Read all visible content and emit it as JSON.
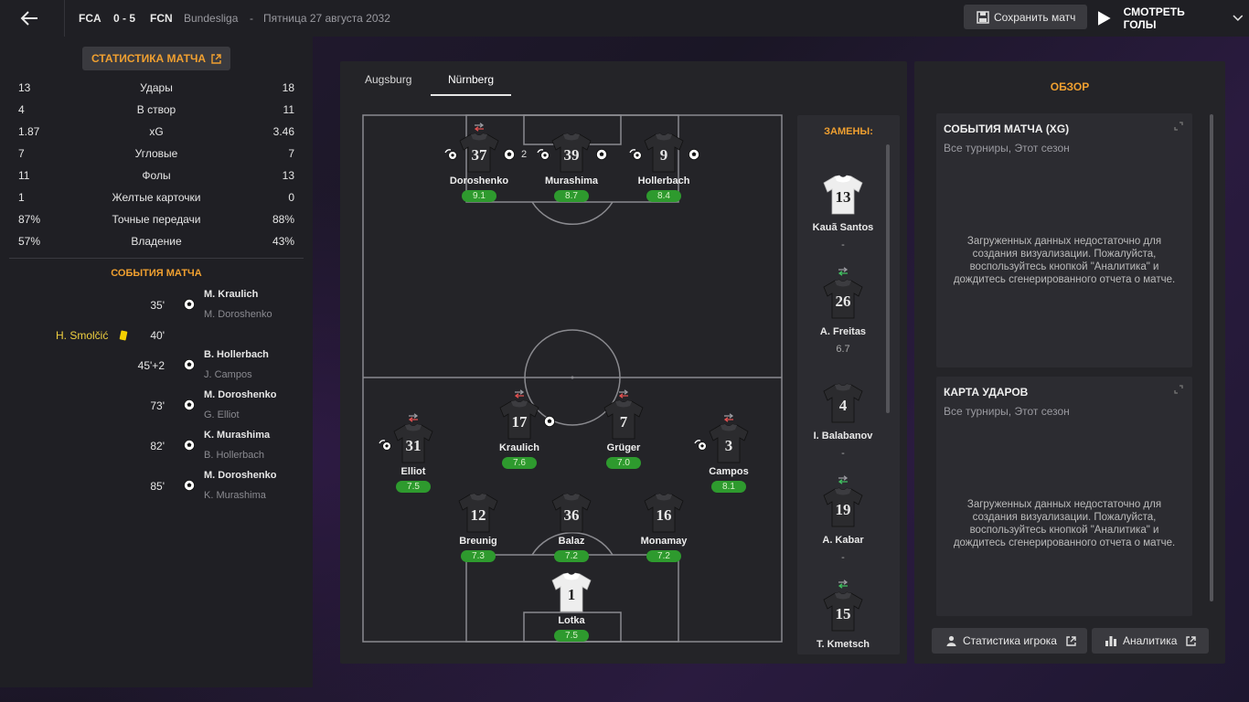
{
  "header": {
    "home_abbr": "FCA",
    "score": "0 - 5",
    "away_abbr": "FCN",
    "competition": "Bundesliga",
    "sep": "-",
    "date": "Пятница 27 августа 2032",
    "save_label": "Сохранить матч",
    "watch_label": "СМОТРЕТЬ ГОЛЫ"
  },
  "left": {
    "stats_button": "СТАТИСТИКА МАТЧА",
    "stats": [
      {
        "home": "13",
        "label": "Удары",
        "away": "18"
      },
      {
        "home": "4",
        "label": "В створ",
        "away": "11"
      },
      {
        "home": "1.87",
        "label": "xG",
        "away": "3.46"
      },
      {
        "home": "7",
        "label": "Угловые",
        "away": "7"
      },
      {
        "home": "11",
        "label": "Фолы",
        "away": "13"
      },
      {
        "home": "1",
        "label": "Желтые карточки",
        "away": "0"
      },
      {
        "home": "87%",
        "label": "Точные передачи",
        "away": "88%"
      },
      {
        "home": "57%",
        "label": "Владение",
        "away": "43%"
      }
    ],
    "events_title": "СОБЫТИЯ МАТЧА",
    "events": [
      {
        "minute": "35'",
        "type": "goal",
        "player": "M. Kraulich",
        "assist": "M. Doroshenko"
      },
      {
        "minute": "40'",
        "type": "yellow",
        "home_player": "H. Smolčić"
      },
      {
        "minute": "45'+2",
        "type": "goal",
        "player": "B. Hollerbach",
        "assist": "J. Campos"
      },
      {
        "minute": "73'",
        "type": "goal",
        "player": "M. Doroshenko",
        "assist": "G. Elliot"
      },
      {
        "minute": "82'",
        "type": "goal",
        "player": "K. Murashima",
        "assist": "B. Hollerbach"
      },
      {
        "minute": "85'",
        "type": "goal",
        "player": "M. Doroshenko",
        "assist": "K. Murashima"
      }
    ]
  },
  "middle": {
    "tabs": [
      "Augsburg",
      "Nürnberg"
    ],
    "active_tab": "Nürnberg",
    "players": [
      {
        "num": "37",
        "name": "Doroshenko",
        "rating": "9.1",
        "kit": "dark",
        "sub_off": true,
        "assist": true,
        "goals": "2"
      },
      {
        "num": "39",
        "name": "Murashima",
        "rating": "8.7",
        "kit": "dark",
        "assist": true,
        "goals": "1"
      },
      {
        "num": "9",
        "name": "Hollerbach",
        "rating": "8.4",
        "kit": "dark",
        "assist": true,
        "goals": "1"
      },
      {
        "num": "31",
        "name": "Elliot",
        "rating": "7.5",
        "kit": "dark",
        "sub_off": true,
        "assist": true
      },
      {
        "num": "17",
        "name": "Kraulich",
        "rating": "7.6",
        "kit": "dark",
        "sub_off": true,
        "goals": "1"
      },
      {
        "num": "7",
        "name": "Grüger",
        "rating": "7.0",
        "kit": "dark",
        "sub_off": true
      },
      {
        "num": "3",
        "name": "Campos",
        "rating": "8.1",
        "kit": "dark",
        "sub_off": true,
        "assist": true
      },
      {
        "num": "12",
        "name": "Breunig",
        "rating": "7.3",
        "kit": "dark"
      },
      {
        "num": "36",
        "name": "Balaz",
        "rating": "7.2",
        "kit": "dark"
      },
      {
        "num": "16",
        "name": "Monamay",
        "rating": "7.2",
        "kit": "dark"
      },
      {
        "num": "1",
        "name": "Lotka",
        "rating": "7.5",
        "kit": "light"
      }
    ],
    "subs_title": "ЗАМЕНЫ:",
    "subs": [
      {
        "num": "13",
        "name": "Kauã Santos",
        "value": "-",
        "kit": "light",
        "sub_on": false
      },
      {
        "num": "26",
        "name": "A. Freitas",
        "value": "6.7",
        "kit": "dark",
        "sub_on": true
      },
      {
        "num": "4",
        "name": "I. Balabanov",
        "value": "-",
        "kit": "dark",
        "sub_on": false
      },
      {
        "num": "19",
        "name": "A. Kabar",
        "value": "-",
        "kit": "dark",
        "sub_on": true
      },
      {
        "num": "15",
        "name": "T. Kmetsch",
        "value": "",
        "kit": "dark",
        "sub_on": true
      }
    ]
  },
  "right": {
    "title": "ОБЗОР",
    "cards": [
      {
        "title": "СОБЫТИЯ МАТЧА (XG)",
        "subtitle": "Все турниры, Этот сезон",
        "message": "Загруженных данных недостаточно для создания визуализации. Пожалуйста, воспользуйтесь кнопкой \"Аналитика\" и дождитесь сгенерированного отчета о матче."
      },
      {
        "title": "КАРТА УДАРОВ",
        "subtitle": "Все турниры, Этот сезон",
        "message": "Загруженных данных недостаточно для создания визуализации. Пожалуйста, воспользуйтесь кнопкой \"Аналитика\" и дождитесь сгенерированного отчета о матче."
      }
    ],
    "player_stats_button": "Статистика игрока",
    "analytics_button": "Аналитика"
  },
  "colors": {
    "accent": "#f0a030",
    "rating_green": "#2e9a2e",
    "yellow_card": "#f5d000",
    "sub_off": "#e05050",
    "sub_on": "#40c060"
  },
  "icons": [
    "back-arrow-icon",
    "save-icon",
    "play-icon",
    "chevron-down-icon",
    "external-link-icon",
    "ball-icon",
    "assist-icon",
    "yellow-card-icon",
    "sub-off-icon",
    "sub-on-icon",
    "player-icon",
    "bar-chart-icon"
  ]
}
